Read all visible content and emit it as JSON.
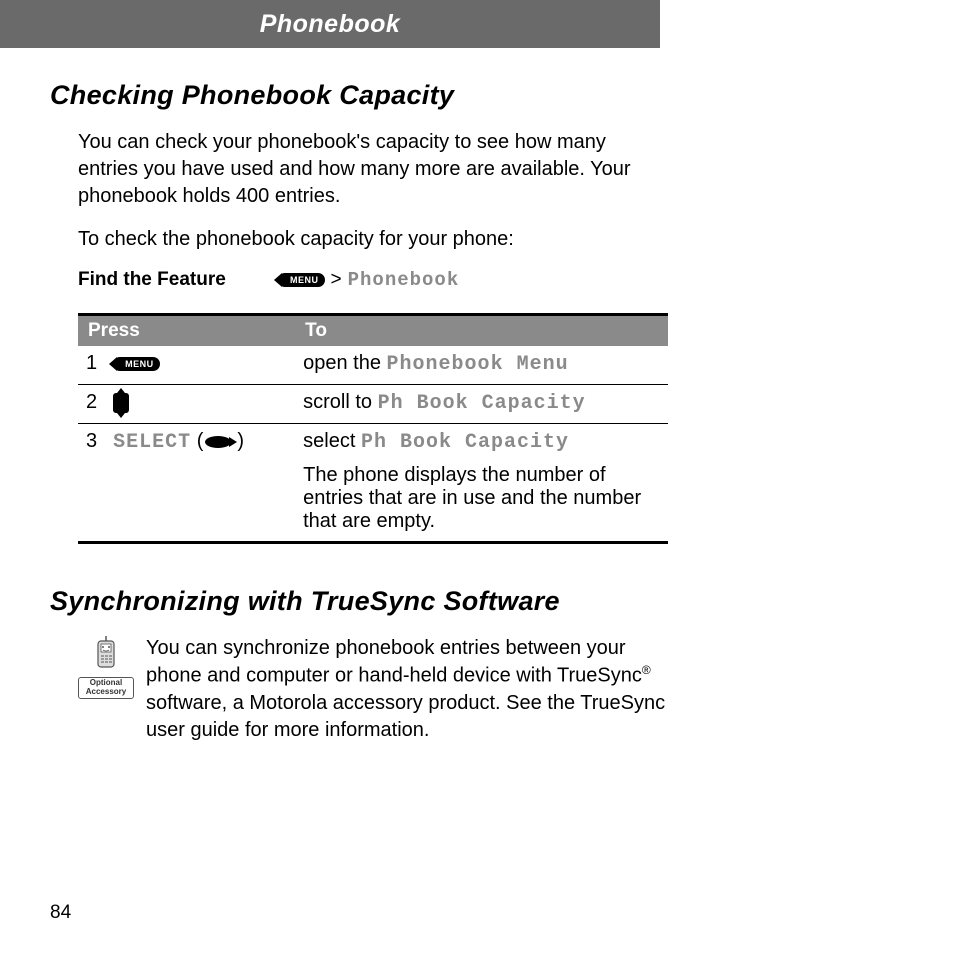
{
  "header": {
    "title": "Phonebook"
  },
  "section1": {
    "heading": "Checking Phonebook Capacity",
    "p1": "You can check your phonebook's capacity to see how many entries you have used and how many more are available. Your phonebook holds 400 entries.",
    "p2": "To check the phonebook capacity for your phone:"
  },
  "findFeature": {
    "label": "Find the Feature",
    "keyText": "MENU",
    "sep": ">",
    "path": "Phonebook"
  },
  "table": {
    "headers": {
      "press": "Press",
      "to": "To"
    },
    "rows": [
      {
        "num": "1",
        "keyText": "MENU",
        "action_pre": "open the ",
        "action_code": "Phonebook Menu"
      },
      {
        "num": "2",
        "action_pre": "scroll to ",
        "action_code": "Ph Book Capacity"
      },
      {
        "num": "3",
        "select_label": "SELECT",
        "action_pre": "select ",
        "action_code": "Ph Book Capacity",
        "extra": "The phone displays the number of entries that are in use and the number that are empty."
      }
    ]
  },
  "section2": {
    "heading": "Synchronizing with TrueSync Software",
    "accessoryLabel": "Optional Accessory",
    "text_pre": "You can synchronize phonebook entries between your phone and computer or hand-held device with TrueSync",
    "reg": "®",
    "text_post": " software, a Motorola accessory product. See the TrueSync user guide for more information."
  },
  "pageNumber": "84"
}
